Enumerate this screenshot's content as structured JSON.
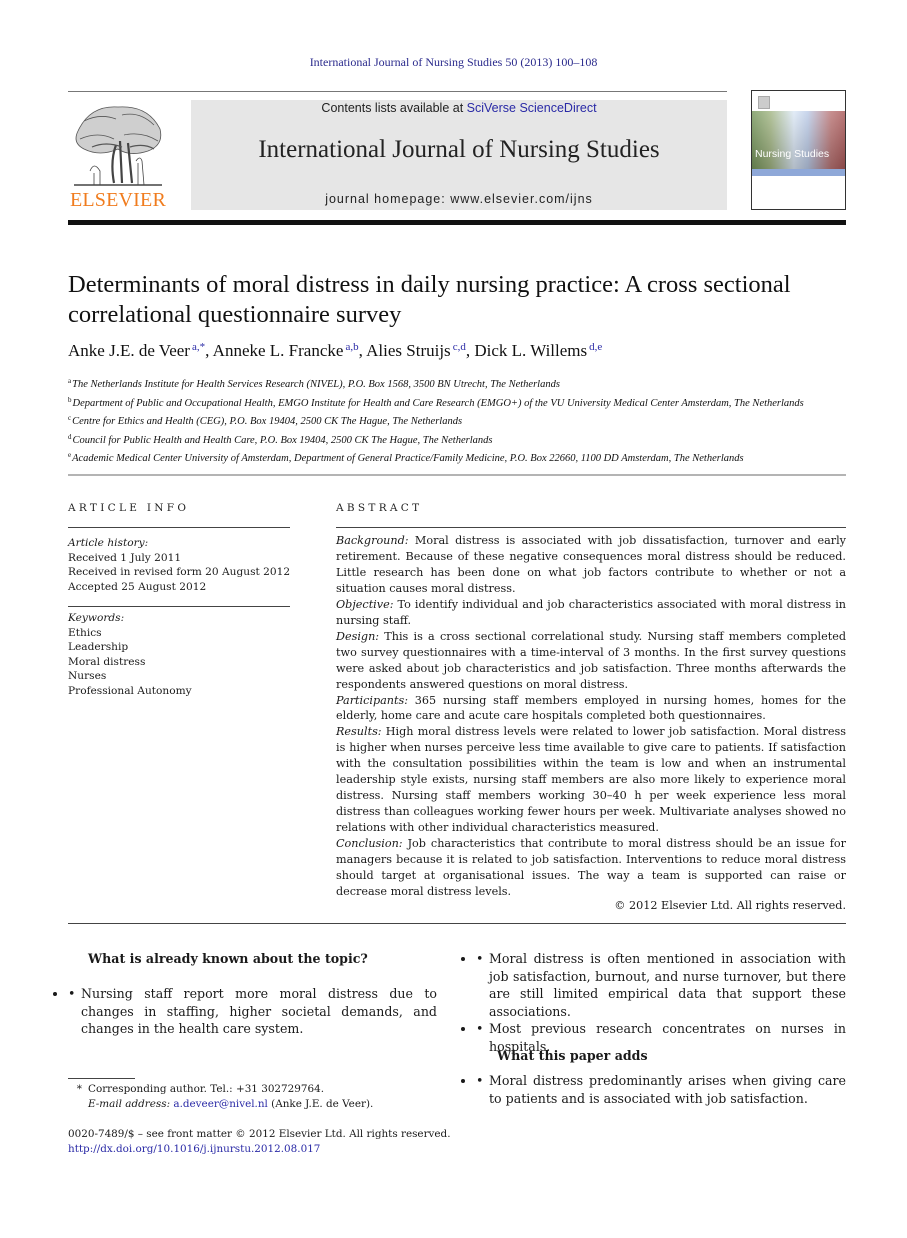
{
  "running_head": "International Journal of Nursing Studies 50 (2013) 100–108",
  "masthead": {
    "publisher_logo_text": "ELSEVIER",
    "contents_prefix": "Contents lists available at ",
    "contents_link": "SciVerse ScienceDirect",
    "journal_title": "International Journal of Nursing Studies",
    "homepage_label": "journal homepage: ",
    "homepage_url": "www.elsevier.com/ijns",
    "cover_title": "Nursing Studies"
  },
  "colors": {
    "link": "#2a2aa6",
    "elsevier_orange": "#f07c1e",
    "banner_bg": "#e6e6e6"
  },
  "article": {
    "title_line1": "Determinants of moral distress in daily nursing practice: A cross sectional",
    "title_line2": "correlational questionnaire survey",
    "authors": [
      {
        "name": "Anke J.E. de Veer",
        "sup": "a,*",
        "sep": ", "
      },
      {
        "name": "Anneke L. Francke",
        "sup": "a,b",
        "sep": ", "
      },
      {
        "name": "Alies Struijs",
        "sup": "c,d",
        "sep": ", "
      },
      {
        "name": "Dick L. Willems",
        "sup": "d,e",
        "sep": ""
      }
    ],
    "affiliations": [
      {
        "key": "a",
        "text": "The Netherlands Institute for Health Services Research (NIVEL), P.O. Box 1568, 3500 BN Utrecht, The Netherlands"
      },
      {
        "key": "b",
        "text": "Department of Public and Occupational Health, EMGO Institute for Health and Care Research (EMGO+) of the VU University Medical Center Amsterdam, The Netherlands"
      },
      {
        "key": "c",
        "text": "Centre for Ethics and Health (CEG), P.O. Box 19404, 2500 CK The Hague, The Netherlands"
      },
      {
        "key": "d",
        "text": "Council for Public Health and Health Care, P.O. Box 19404, 2500 CK The Hague, The Netherlands"
      },
      {
        "key": "e",
        "text": "Academic Medical Center University of Amsterdam, Department of General Practice/Family Medicine, P.O. Box 22660, 1100 DD Amsterdam, The Netherlands"
      }
    ]
  },
  "article_info": {
    "heading": "ARTICLE INFO",
    "history_label": "Article history:",
    "history": [
      "Received 1 July 2011",
      "Received in revised form 20 August 2012",
      "Accepted 25 August 2012"
    ],
    "keywords_label": "Keywords:",
    "keywords": [
      "Ethics",
      "Leadership",
      "Moral distress",
      "Nurses",
      "Professional Autonomy"
    ]
  },
  "abstract": {
    "heading": "ABSTRACT",
    "sections": [
      {
        "label": "Background:",
        "text": " Moral distress is associated with job dissatisfaction, turnover and early retirement. Because of these negative consequences moral distress should be reduced. Little research has been done on what job factors contribute to whether or not a situation causes moral distress."
      },
      {
        "label": "Objective:",
        "text": "  To identify individual and job characteristics associated with moral distress in nursing staff."
      },
      {
        "label": "Design:",
        "text": "  This is a cross sectional correlational study. Nursing staff members completed two survey questionnaires with a time-interval of 3 months. In the first survey questions were asked about job characteristics and job satisfaction. Three months afterwards the respondents answered questions on moral distress."
      },
      {
        "label": "Participants:",
        "text": " 365 nursing staff members employed in nursing homes, homes for the elderly, home care and acute care hospitals completed both questionnaires."
      },
      {
        "label": "Results:",
        "text": "  High moral distress levels were related to lower job satisfaction. Moral distress is higher when nurses perceive less time available to give care to patients. If satisfaction with the consultation possibilities within the team is low and when an instrumental leadership style exists, nursing staff members are also more likely to experience moral distress. Nursing staff members working 30–40 h per week experience less moral distress than colleagues working fewer hours per week. Multivariate analyses showed no relations with other individual characteristics measured."
      },
      {
        "label": "Conclusion:",
        "text": " Job characteristics that contribute to moral distress should be an issue for managers because it is related to job satisfaction. Interventions to reduce moral distress should target at organisational issues. The way a team is supported can raise or decrease moral distress levels."
      }
    ],
    "copyright": "© 2012 Elsevier Ltd. All rights reserved."
  },
  "summary_box": {
    "known_heading": "What is already known about the topic?",
    "known": [
      "Nursing staff report more moral distress due to changes in staffing, higher societal demands, and changes in the health care system.",
      "Moral distress is often mentioned in association with job satisfaction, burnout, and nurse turnover, but there are still limited empirical data that support these associations.",
      "Most previous research concentrates on nurses in hospitals."
    ],
    "adds_heading": "What this paper adds",
    "adds": [
      "Moral distress predominantly arises when giving care to patients and is associated with job satisfaction."
    ]
  },
  "footnote": {
    "star": "*",
    "corresponding": "Corresponding author. Tel.: +31 302729764.",
    "email_label": "E-mail address: ",
    "email": "a.deveer@nivel.nl",
    "email_suffix": " (Anke J.E. de Veer).",
    "issn_line": "0020-7489/$ – see front matter © 2012 Elsevier Ltd. All rights reserved.",
    "doi": "http://dx.doi.org/10.1016/j.ijnurstu.2012.08.017"
  }
}
